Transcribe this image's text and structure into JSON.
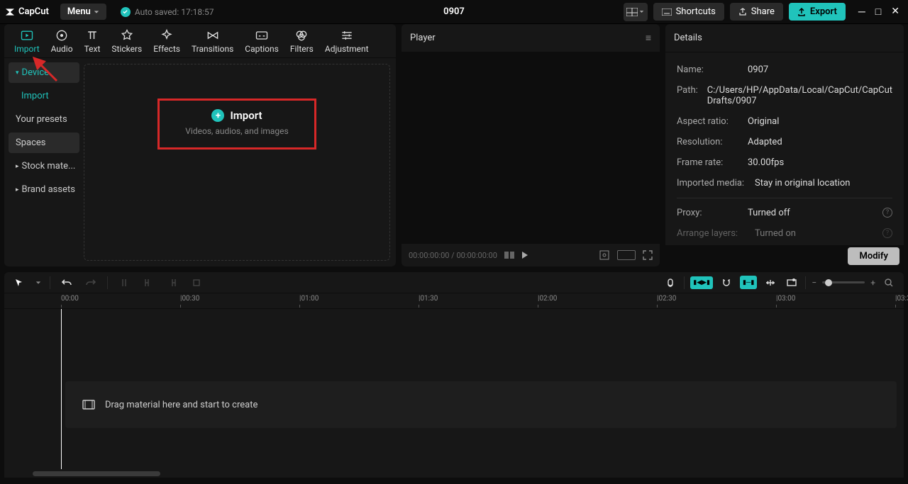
{
  "app": {
    "name": "CapCut"
  },
  "titlebar": {
    "menu": "Menu",
    "autosaved": "Auto saved: 17:18:57",
    "project_title": "0907",
    "shortcuts": "Shortcuts",
    "share": "Share",
    "export": "Export"
  },
  "tabs": [
    "Import",
    "Audio",
    "Text",
    "Stickers",
    "Effects",
    "Transitions",
    "Captions",
    "Filters",
    "Adjustment"
  ],
  "active_tab": "Import",
  "sidebar": {
    "device": "Device",
    "import_link": "Import",
    "your_presets": "Your presets",
    "spaces": "Spaces",
    "stock_materials": "Stock mate...",
    "brand_assets": "Brand assets"
  },
  "import_box": {
    "title": "Import",
    "subtitle": "Videos, audios, and images"
  },
  "player": {
    "title": "Player",
    "time_current": "00:00:00:00",
    "time_total": "00:00:00:00"
  },
  "details": {
    "title": "Details",
    "rows": {
      "name": {
        "label": "Name:",
        "value": "0907"
      },
      "path": {
        "label": "Path:",
        "value": "C:/Users/HP/AppData/Local/CapCut/CapCut Drafts/0907"
      },
      "aspect": {
        "label": "Aspect ratio:",
        "value": "Original"
      },
      "resolution": {
        "label": "Resolution:",
        "value": "Adapted"
      },
      "framerate": {
        "label": "Frame rate:",
        "value": "30.00fps"
      },
      "imported": {
        "label": "Imported media:",
        "value": "Stay in original location"
      },
      "proxy": {
        "label": "Proxy:",
        "value": "Turned off"
      },
      "layers": {
        "label": "Arrange layers:",
        "value": "Turned on"
      }
    },
    "modify": "Modify"
  },
  "timeline": {
    "marks": [
      "00:00",
      "|00:30",
      "|01:00",
      "|01:30",
      "|02:00",
      "|02:30",
      "|03:00",
      "|03:3"
    ],
    "drop_hint": "Drag material here and start to create"
  }
}
